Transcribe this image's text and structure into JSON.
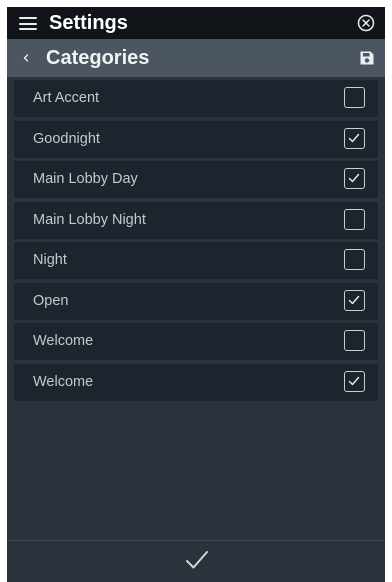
{
  "header": {
    "title": "Settings",
    "menu_icon": "hamburger-icon",
    "close_icon": "close-circle-icon"
  },
  "subheader": {
    "title": "Categories",
    "back_icon": "chevron-left-icon",
    "save_icon": "floppy-disk-icon"
  },
  "categories": [
    {
      "label": "Art Accent",
      "checked": false
    },
    {
      "label": "Goodnight",
      "checked": true
    },
    {
      "label": "Main Lobby Day",
      "checked": true
    },
    {
      "label": "Main Lobby Night",
      "checked": false
    },
    {
      "label": "Night",
      "checked": false
    },
    {
      "label": "Open",
      "checked": true
    },
    {
      "label": "Welcome",
      "checked": false
    },
    {
      "label": "Welcome",
      "checked": true
    }
  ],
  "footer": {
    "confirm_icon": "checkmark-icon"
  },
  "colors": {
    "topbar": "#111418",
    "subbar": "#4b5662",
    "background": "#2b323c",
    "row": "#1e242d",
    "text": "#c4c9cf"
  }
}
